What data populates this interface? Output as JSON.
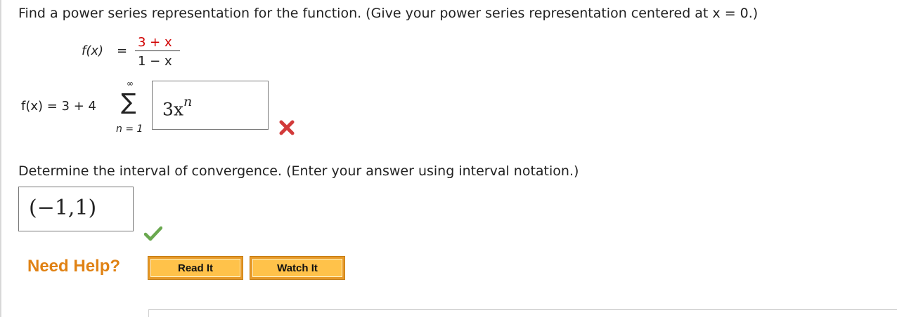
{
  "question": {
    "prompt": "Find a power series representation for the function. (Give your power series representation centered at x = 0.)",
    "function_lhs": "f(x)",
    "equals": "=",
    "numerator": "3 + x",
    "denominator": "1 − x",
    "series_lhs": "f(x) = 3 + 4",
    "sigma": "∑",
    "sum_upper": "∞",
    "sum_lower": "n = 1",
    "answer_term": "3x",
    "answer_exp": "n",
    "answer_status": "incorrect"
  },
  "interval": {
    "prompt": "Determine the interval of convergence. (Enter your answer using interval notation.)",
    "answer": "(−1,1)",
    "answer_status": "correct"
  },
  "help": {
    "label": "Need Help?",
    "read_it": "Read It",
    "watch_it": "Watch It"
  },
  "colors": {
    "accent_orange": "#e08214",
    "button_fill": "#ffc24a",
    "incorrect_red": "#d00000",
    "correct_green": "#5aa02c"
  }
}
